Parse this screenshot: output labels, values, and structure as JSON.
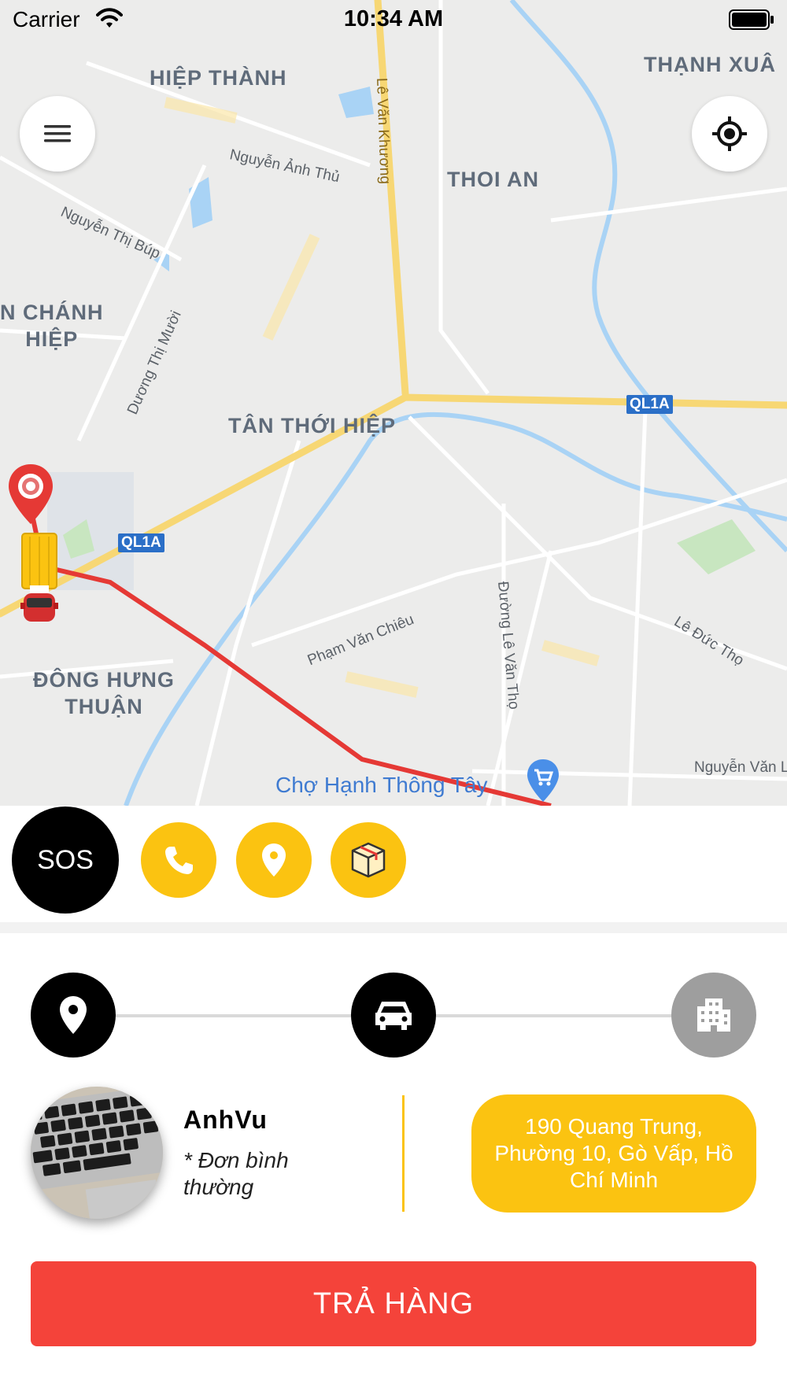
{
  "status_bar": {
    "carrier": "Carrier",
    "time": "10:34 AM"
  },
  "map": {
    "area_labels": {
      "hiep_thanh": "HIỆP THÀNH",
      "thanh_xuan": "THẠNH XUÂ",
      "thoi_an": "THOI AN",
      "chanh_hiep": "N CHÁNH\nHIỆP",
      "tan_thoi_hiep": "TÂN THỚI HIỆP",
      "dong_hung_thuan": "ĐÔNG HƯNG\nTHUẬN"
    },
    "streets": {
      "nguyen_anh_thu": "Nguyễn Ảnh Thủ",
      "nguyen_thi_bup": "Nguyễn Thị Búp",
      "le_van_khuong": "Lê Văn Khương",
      "duong_thi_muoi": "Dương Thị Mười",
      "pham_van_chieu": "Phạm Văn Chiêu",
      "duong_le_van_tho": "Đường Lê Văn Thọ",
      "le_duc_tho": "Lê Đức Thọ",
      "nguyen_van_l": "Nguyễn Văn L"
    },
    "route_shields": [
      "QL1A",
      "QL1A"
    ],
    "poi": "Chợ Hạnh Thông Tây",
    "icons": {
      "menu": "menu-icon",
      "locate": "my-location-icon",
      "origin_pin": "origin-pin-icon",
      "vehicle": "truck-icon",
      "poi": "shopping-cart-pin-icon"
    },
    "colors": {
      "route": "#e53935",
      "road_major": "#f7d774",
      "water": "#a9d3f5",
      "park": "#c8e6c0"
    }
  },
  "actions": {
    "sos_label": "SOS",
    "icons": [
      "phone-icon",
      "location-pin-icon",
      "package-icon"
    ],
    "accent": "#fbc311"
  },
  "progress": {
    "steps": [
      "pickup-pin-icon",
      "car-icon",
      "building-icon"
    ],
    "active_color": "#000000",
    "inactive_color": "#9e9e9e"
  },
  "order": {
    "customer_name": "AnhVu",
    "note": "* Đơn bình thường",
    "address": "190 Quang Trung, Phường 10, Gò Vấp, Hồ Chí Minh"
  },
  "cta": {
    "label": "TRẢ HÀNG",
    "color": "#f4433a"
  }
}
